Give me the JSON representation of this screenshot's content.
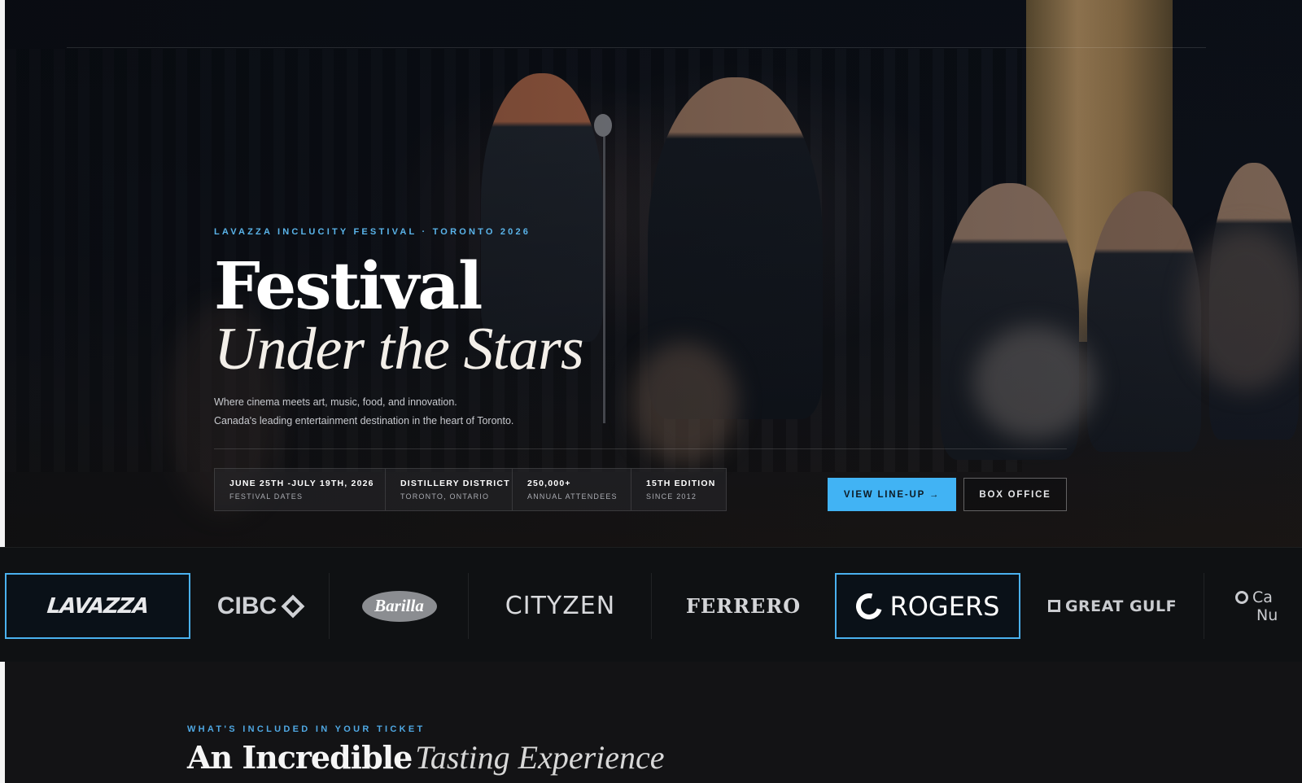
{
  "hero": {
    "eyebrow": "LAVAZZA INCLUCITY FESTIVAL · TORONTO 2026",
    "title_main": "Festival",
    "title_sub": "Under the Stars",
    "description_line1": "Where cinema meets art, music, food, and innovation.",
    "description_line2": "Canada's leading entertainment destination in the heart of Toronto.",
    "stats": [
      {
        "value": "JUNE 25TH -JULY 19TH, 2026",
        "label": "FESTIVAL DATES"
      },
      {
        "value": "DISTILLERY DISTRICT",
        "label": "TORONTO, ONTARIO"
      },
      {
        "value": "250,000+",
        "label": "ANNUAL ATTENDEES"
      },
      {
        "value": "15TH EDITION",
        "label": "SINCE 2012"
      }
    ],
    "primary_button": "VIEW LINE-UP →",
    "secondary_button": "BOX OFFICE"
  },
  "sponsors": {
    "items": [
      {
        "name": "LAVAZZA",
        "featured": true
      },
      {
        "name": "CIBC",
        "featured": false
      },
      {
        "name": "Barilla",
        "featured": false
      },
      {
        "name": "CITYZEN",
        "featured": false
      },
      {
        "name": "FERRERO",
        "featured": false
      },
      {
        "name": "ROGERS",
        "featured": true
      },
      {
        "name": "GREAT GULF",
        "featured": false
      },
      {
        "name": "Ca",
        "name_line2": "Nu",
        "featured": false
      }
    ]
  },
  "included": {
    "eyebrow": "WHAT'S INCLUDED IN YOUR TICKET",
    "title_bold": "An Incredible",
    "title_italic": "Tasting Experience"
  },
  "colors": {
    "accent": "#41b3f4",
    "background": "#131315",
    "sponsor_strip": "#0f1113"
  }
}
